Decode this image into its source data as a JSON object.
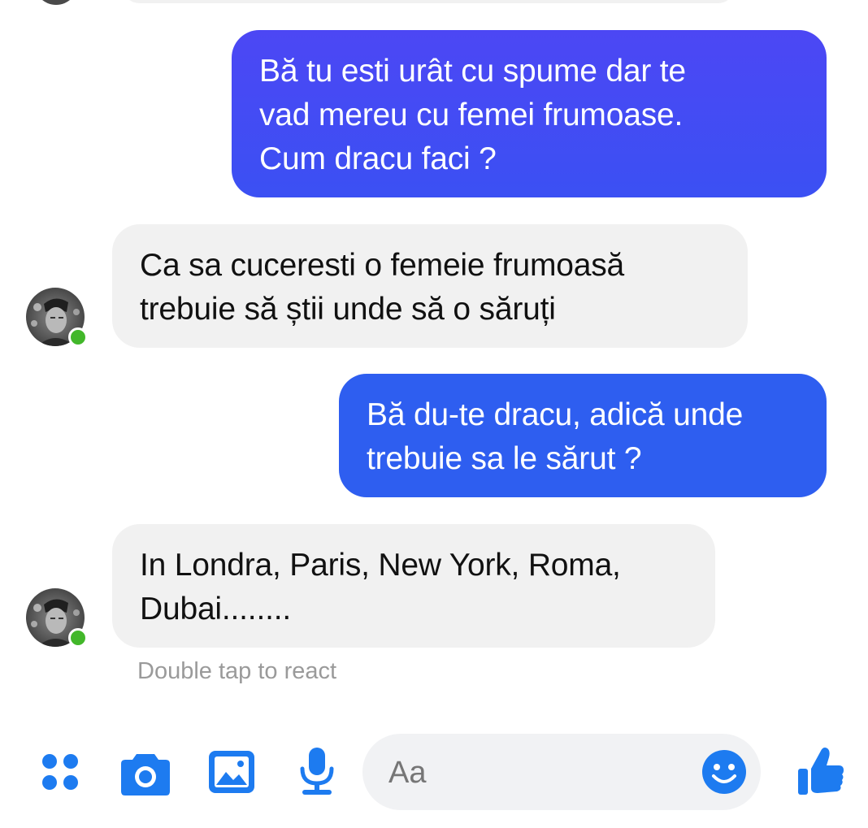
{
  "messages": [
    {
      "direction": "outgoing",
      "lines": [
        "Bă tu esti urât cu spume dar te",
        "vad mereu cu femei frumoase.",
        "Cum dracu faci ?"
      ]
    },
    {
      "direction": "incoming",
      "lines": [
        "Ca sa cuceresti o femeie frumoasă",
        "trebuie să știi unde să o săruți"
      ]
    },
    {
      "direction": "outgoing",
      "lines": [
        "Bă du-te dracu, adică unde",
        "trebuie sa le sărut ?"
      ]
    },
    {
      "direction": "incoming",
      "lines": [
        "In Londra, Paris, New York, Roma,",
        "Dubai........"
      ]
    }
  ],
  "reaction_hint": "Double tap to react",
  "composer": {
    "placeholder": "Aa",
    "icons": [
      "apps-icon",
      "camera-icon",
      "image-icon",
      "microphone-icon",
      "emoji-icon",
      "thumbs-up-icon"
    ]
  },
  "colors": {
    "outgoing_bubble": "#3b50f3",
    "outgoing_bubble_alt": "#2e5ef0",
    "incoming_bubble": "#f1f1f1",
    "accent_icons": "#1d7bf0",
    "online_indicator": "#42b72a"
  }
}
